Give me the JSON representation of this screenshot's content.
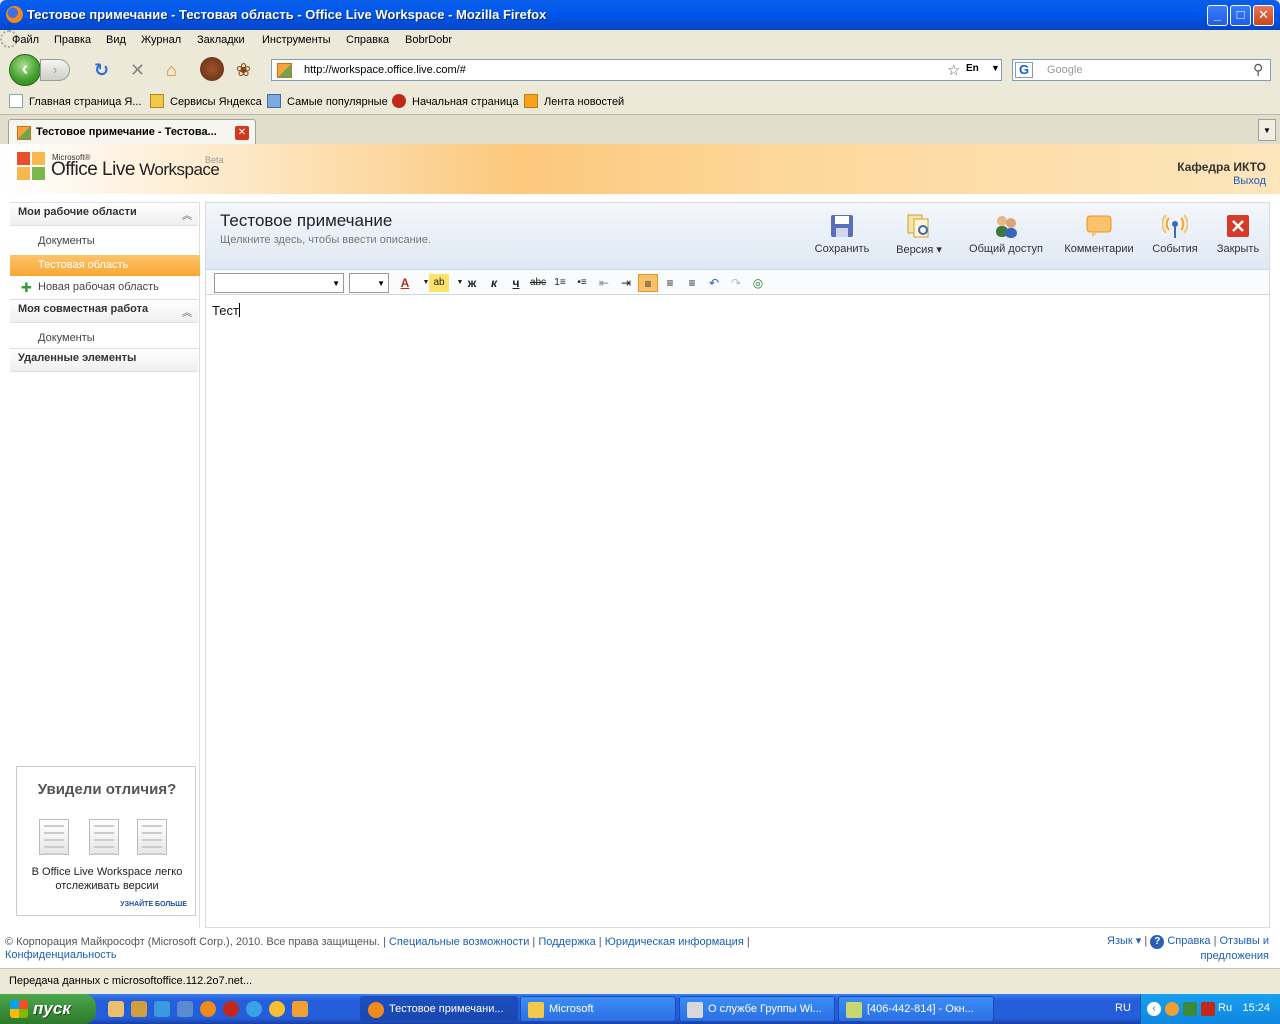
{
  "window": {
    "title": "Тестовое примечание - Тестовая область - Office Live Workspace - Mozilla Firefox",
    "min": "_",
    "max": "□",
    "close": "✕"
  },
  "menu": [
    "Файл",
    "Правка",
    "Вид",
    "Журнал",
    "Закладки",
    "Инструменты",
    "Справка",
    "BobrDobr"
  ],
  "nav": {
    "back": "‹",
    "forward": "›",
    "url": "http://workspace.office.live.com/#",
    "lang": "En",
    "search_placeholder": "Google"
  },
  "bookmarks": [
    "Главная страница Я...",
    "Сервисы Яндекса",
    "Самые популярные",
    "Начальная страница",
    "Лента новостей"
  ],
  "tabs": [
    {
      "label": "Тестовое примечание - Тестова..."
    }
  ],
  "app": {
    "brand": {
      "ms": "Microsoft®",
      "name": "Office Live",
      "name2": " Workspace",
      "beta": "Beta"
    },
    "user": "Кафедра ИКТО",
    "exit": "Выход",
    "sidebar": {
      "section1": "Мои рабочие области",
      "items1": [
        "Документы",
        "Тестовая область",
        "Новая рабочая область"
      ],
      "section2": "Моя совместная работа",
      "items2": [
        "Документы"
      ],
      "section3": "Удаленные элементы"
    },
    "promo": {
      "title": "Увидели отличия?",
      "desc1": "В Office Live Workspace легко",
      "desc2": "отслеживать версии",
      "more": "УЗНАЙТЕ БОЛЬШЕ"
    },
    "page": {
      "title": "Тестовое примечание",
      "desc": "Щелкните здесь, чтобы ввести описание."
    },
    "actions": [
      "Сохранить",
      "Версия ▾",
      "Общий доступ",
      "Комментарии",
      "События",
      "Закрыть"
    ],
    "format_buttons": [
      "A",
      "ab",
      "ж",
      "к",
      "ч",
      "abc",
      "1≡",
      "•≡",
      "⇤",
      "⇥",
      "≡",
      "≡",
      "≡",
      "↶",
      "↷",
      "◎"
    ],
    "editor_text": "Тест",
    "footer": {
      "copyright": "© Корпорация Майкрософт (Microsoft Corp.), 2010. Все права защищены. |",
      "links": [
        "Специальные возможности",
        "Поддержка",
        "Юридическая информация",
        "Конфиденциальность"
      ],
      "lang": "Язык ▾",
      "help": "Справка",
      "feedback1": "Отзывы и",
      "feedback2": "предложения"
    }
  },
  "status": "Передача данных с microsoftoffice.112.2o7.net...",
  "taskbar": {
    "start": "пуск",
    "tasks": [
      "Тестовое примечани...",
      "Microsoft",
      "О службе Группы Wi...",
      "[406-442-814] - Окн..."
    ],
    "lang": "RU",
    "tray_lang": "Ru",
    "time": "15:24"
  }
}
